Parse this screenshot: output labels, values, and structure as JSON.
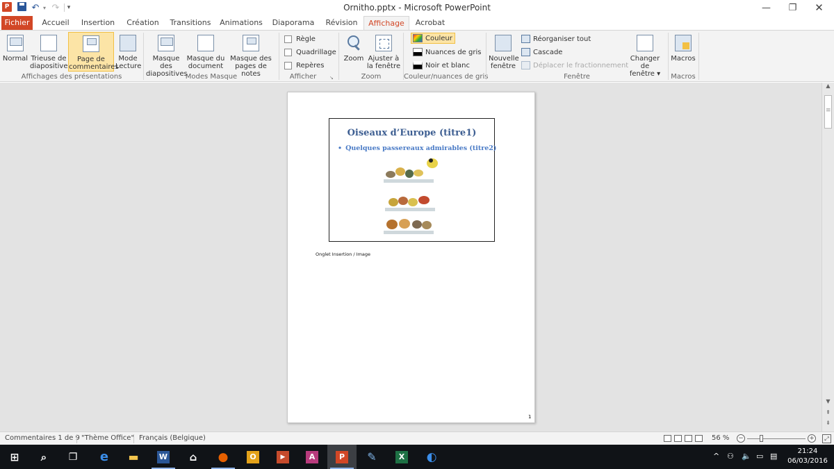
{
  "window": {
    "title": "Ornitho.pptx - Microsoft PowerPoint",
    "min_glyph": "—",
    "restore_glyph": "❐",
    "close_glyph": "✕"
  },
  "quick_access": {
    "app_glyph": "P",
    "undo_glyph": "↶",
    "redo_glyph": "↷",
    "dropdown_glyph": "▾"
  },
  "tabs": [
    {
      "label": "Fichier"
    },
    {
      "label": "Accueil"
    },
    {
      "label": "Insertion"
    },
    {
      "label": "Création"
    },
    {
      "label": "Transitions"
    },
    {
      "label": "Animations"
    },
    {
      "label": "Diaporama"
    },
    {
      "label": "Révision"
    },
    {
      "label": "Affichage"
    },
    {
      "label": "Acrobat"
    }
  ],
  "ribbon_controls": {
    "minimize_glyph": "^",
    "help_glyph": "?"
  },
  "ribbon": {
    "groups": {
      "presentation_views": "Affichages des présentations",
      "master_views": "Modes Masque",
      "show": "Afficher",
      "zoom": "Zoom",
      "color": "Couleur/nuances de gris",
      "window": "Fenêtre",
      "macros": "Macros"
    },
    "buttons": {
      "normal": "Normal",
      "slide_sorter": "Trieuse de\ndiapositives",
      "notes_page": "Page de\ncommentaires",
      "reading_view": "Mode\nLecture",
      "slide_master": "Masque des\ndiapositives",
      "handout_master": "Masque du\ndocument",
      "notes_master": "Masque des\npages de notes",
      "zoom": "Zoom",
      "fit_window": "Ajuster à\nla fenêtre",
      "new_window": "Nouvelle\nfenêtre",
      "switch_windows": "Changer de\nfenêtre ▾",
      "macros": "Macros"
    },
    "show": {
      "ruler": "Règle",
      "gridlines": "Quadrillage",
      "guides": "Repères",
      "launcher_glyph": "↘"
    },
    "color": {
      "color": "Couleur",
      "grayscale": "Nuances de gris",
      "black_white": "Noir et blanc"
    },
    "window": {
      "arrange_all": "Réorganiser tout",
      "cascade": "Cascade",
      "move_split": "Déplacer le fractionnement"
    }
  },
  "notes_page": {
    "slide_title": "Oiseaux d’Europe (titre1)",
    "bullet_glyph": "•",
    "slide_subtitle": "Quelques passereaux admirables (titre2)",
    "notes_text": "Onglet Insertion / Image",
    "page_number": "1"
  },
  "scrollbar": {
    "up_glyph": "▲",
    "down_glyph": "▼",
    "prev_page_glyph": "⇞",
    "next_page_glyph": "⇟"
  },
  "status": {
    "notes_count": "Commentaires 1 de 9",
    "theme": "\"Thème Office\"",
    "language": "Français (Belgique)",
    "zoom": "56 %",
    "zoom_out_glyph": "−",
    "zoom_in_glyph": "+",
    "fit_glyph": "⤢",
    "zoom_level": 0.56
  },
  "taskbar": {
    "apps": [
      {
        "icon": "windows-start-icon",
        "glyph": "⊞"
      },
      {
        "icon": "search-icon",
        "glyph": "⌕"
      },
      {
        "icon": "task-view-icon",
        "glyph": "❐"
      },
      {
        "icon": "edge-icon",
        "glyph": "e"
      },
      {
        "icon": "file-explorer-icon",
        "glyph": "▬"
      },
      {
        "icon": "word-icon",
        "glyph": "W"
      },
      {
        "icon": "store-icon",
        "glyph": "⌂"
      },
      {
        "icon": "firefox-icon",
        "glyph": "●"
      },
      {
        "icon": "outlook-icon",
        "glyph": "O"
      },
      {
        "icon": "media-player-icon",
        "glyph": "▶"
      },
      {
        "icon": "access-icon",
        "glyph": "A"
      },
      {
        "icon": "powerpoint-icon",
        "glyph": "P"
      },
      {
        "icon": "paint-icon",
        "glyph": "✎"
      },
      {
        "icon": "excel-icon",
        "glyph": "X"
      },
      {
        "icon": "cloud-app-icon",
        "glyph": "◐"
      }
    ],
    "tray": {
      "chevron_glyph": "^",
      "network_glyph": "⚇",
      "volume_glyph": "🔈",
      "battery_glyph": "▭",
      "notifications_glyph": "▤"
    },
    "time": "21:24",
    "date": "06/03/2016"
  },
  "colors": {
    "accent": "#d24726",
    "title_blue": "#3e5f92",
    "subtitle_blue": "#4a7bc6",
    "selected_bg": "#fce4a6"
  }
}
